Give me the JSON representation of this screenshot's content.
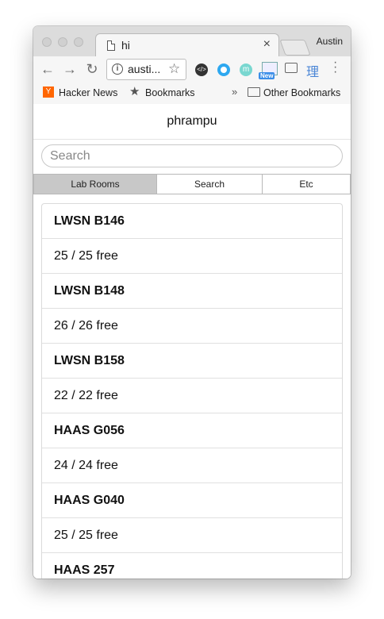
{
  "browser": {
    "tab_title": "hi",
    "tab_close": "×",
    "profile_name": "Austin",
    "url": "austi...",
    "extensions": {
      "code": "</>",
      "m": "m",
      "new_badge": "New",
      "kanji": "理"
    },
    "bookmarks": [
      {
        "label": "Hacker News",
        "icon": "Y"
      },
      {
        "label": "Bookmarks"
      }
    ],
    "overflow": "»",
    "other_bookmarks": "Other Bookmarks"
  },
  "app": {
    "title": "phrampu",
    "search_placeholder": "Search",
    "tabs": [
      {
        "label": "Lab Rooms",
        "active": true
      },
      {
        "label": "Search",
        "active": false
      },
      {
        "label": "Etc",
        "active": false
      }
    ],
    "rooms": [
      {
        "name": "LWSN B146",
        "status": "25 / 25 free"
      },
      {
        "name": "LWSN B148",
        "status": "26 / 26 free"
      },
      {
        "name": "LWSN B158",
        "status": "22 / 22 free"
      },
      {
        "name": "HAAS G056",
        "status": "24 / 24 free"
      },
      {
        "name": "HAAS G040",
        "status": "25 / 25 free"
      },
      {
        "name": "HAAS 257",
        "status": ""
      }
    ]
  }
}
